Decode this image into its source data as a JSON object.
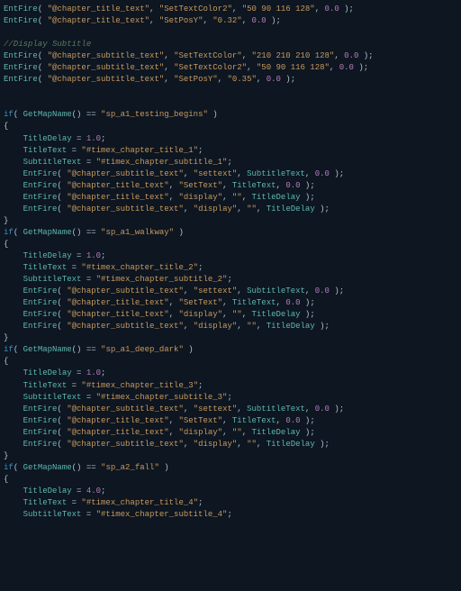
{
  "lines": [
    [
      [
        "f",
        "EntFire"
      ],
      [
        "p",
        "( "
      ],
      [
        "s",
        "\"@chapter_title_text\""
      ],
      [
        "p",
        ", "
      ],
      [
        "s",
        "\"SetTextColor2\""
      ],
      [
        "p",
        ", "
      ],
      [
        "s",
        "\"50 90 116 128\""
      ],
      [
        "p",
        ", "
      ],
      [
        "n",
        "0.0"
      ],
      [
        "p",
        " );"
      ]
    ],
    [
      [
        "f",
        "EntFire"
      ],
      [
        "p",
        "( "
      ],
      [
        "s",
        "\"@chapter_title_text\""
      ],
      [
        "p",
        ", "
      ],
      [
        "s",
        "\"SetPosY\""
      ],
      [
        "p",
        ", "
      ],
      [
        "s",
        "\"0.32\""
      ],
      [
        "p",
        ", "
      ],
      [
        "n",
        "0.0"
      ],
      [
        "p",
        " );"
      ]
    ],
    [],
    [
      [
        "c",
        "//Display Subtitle"
      ]
    ],
    [
      [
        "f",
        "EntFire"
      ],
      [
        "p",
        "( "
      ],
      [
        "s",
        "\"@chapter_subtitle_text\""
      ],
      [
        "p",
        ", "
      ],
      [
        "s",
        "\"SetTextColor\""
      ],
      [
        "p",
        ", "
      ],
      [
        "s",
        "\"210 210 210 128\""
      ],
      [
        "p",
        ", "
      ],
      [
        "n",
        "0.0"
      ],
      [
        "p",
        " );"
      ]
    ],
    [
      [
        "f",
        "EntFire"
      ],
      [
        "p",
        "( "
      ],
      [
        "s",
        "\"@chapter_subtitle_text\""
      ],
      [
        "p",
        ", "
      ],
      [
        "s",
        "\"SetTextColor2\""
      ],
      [
        "p",
        ", "
      ],
      [
        "s",
        "\"50 90 116 128\""
      ],
      [
        "p",
        ", "
      ],
      [
        "n",
        "0.0"
      ],
      [
        "p",
        " );"
      ]
    ],
    [
      [
        "f",
        "EntFire"
      ],
      [
        "p",
        "( "
      ],
      [
        "s",
        "\"@chapter_subtitle_text\""
      ],
      [
        "p",
        ", "
      ],
      [
        "s",
        "\"SetPosY\""
      ],
      [
        "p",
        ", "
      ],
      [
        "s",
        "\"0.35\""
      ],
      [
        "p",
        ", "
      ],
      [
        "n",
        "0.0"
      ],
      [
        "p",
        " );"
      ]
    ],
    [],
    [],
    [
      [
        "k",
        "if"
      ],
      [
        "p",
        "( "
      ],
      [
        "f",
        "GetMapName"
      ],
      [
        "p",
        "() == "
      ],
      [
        "s",
        "\"sp_a1_testing_begins\""
      ],
      [
        "p",
        " )"
      ]
    ],
    [
      [
        "p",
        "{"
      ]
    ],
    [
      [
        "p",
        "    "
      ],
      [
        "f",
        "TitleDelay"
      ],
      [
        "p",
        " = "
      ],
      [
        "n",
        "1.0"
      ],
      [
        "p",
        ";"
      ]
    ],
    [
      [
        "p",
        "    "
      ],
      [
        "f",
        "TitleText"
      ],
      [
        "p",
        " = "
      ],
      [
        "s",
        "\"#timex_chapter_title_1\""
      ],
      [
        "p",
        ";"
      ]
    ],
    [
      [
        "p",
        "    "
      ],
      [
        "f",
        "SubtitleText"
      ],
      [
        "p",
        " = "
      ],
      [
        "s",
        "\"#timex_chapter_subtitle_1\""
      ],
      [
        "p",
        ";"
      ]
    ],
    [
      [
        "p",
        "    "
      ],
      [
        "f",
        "EntFire"
      ],
      [
        "p",
        "( "
      ],
      [
        "s",
        "\"@chapter_subtitle_text\""
      ],
      [
        "p",
        ", "
      ],
      [
        "s",
        "\"settext\""
      ],
      [
        "p",
        ", "
      ],
      [
        "f",
        "SubtitleText"
      ],
      [
        "p",
        ", "
      ],
      [
        "n",
        "0.0"
      ],
      [
        "p",
        " );"
      ]
    ],
    [
      [
        "p",
        "    "
      ],
      [
        "f",
        "EntFire"
      ],
      [
        "p",
        "( "
      ],
      [
        "s",
        "\"@chapter_title_text\""
      ],
      [
        "p",
        ", "
      ],
      [
        "s",
        "\"SetText\""
      ],
      [
        "p",
        ", "
      ],
      [
        "f",
        "TitleText"
      ],
      [
        "p",
        ", "
      ],
      [
        "n",
        "0.0"
      ],
      [
        "p",
        " );"
      ]
    ],
    [
      [
        "p",
        "    "
      ],
      [
        "f",
        "EntFire"
      ],
      [
        "p",
        "( "
      ],
      [
        "s",
        "\"@chapter_title_text\""
      ],
      [
        "p",
        ", "
      ],
      [
        "s",
        "\"display\""
      ],
      [
        "p",
        ", "
      ],
      [
        "s",
        "\"\""
      ],
      [
        "p",
        ", "
      ],
      [
        "f",
        "TitleDelay"
      ],
      [
        "p",
        " );"
      ]
    ],
    [
      [
        "p",
        "    "
      ],
      [
        "f",
        "EntFire"
      ],
      [
        "p",
        "( "
      ],
      [
        "s",
        "\"@chapter_subtitle_text\""
      ],
      [
        "p",
        ", "
      ],
      [
        "s",
        "\"display\""
      ],
      [
        "p",
        ", "
      ],
      [
        "s",
        "\"\""
      ],
      [
        "p",
        ", "
      ],
      [
        "f",
        "TitleDelay"
      ],
      [
        "p",
        " );"
      ]
    ],
    [
      [
        "p",
        "}"
      ]
    ],
    [
      [
        "k",
        "if"
      ],
      [
        "p",
        "( "
      ],
      [
        "f",
        "GetMapName"
      ],
      [
        "p",
        "() == "
      ],
      [
        "s",
        "\"sp_a1_walkway\""
      ],
      [
        "p",
        " )"
      ]
    ],
    [
      [
        "p",
        "{"
      ]
    ],
    [
      [
        "p",
        "    "
      ],
      [
        "f",
        "TitleDelay"
      ],
      [
        "p",
        " = "
      ],
      [
        "n",
        "1.0"
      ],
      [
        "p",
        ";"
      ]
    ],
    [
      [
        "p",
        "    "
      ],
      [
        "f",
        "TitleText"
      ],
      [
        "p",
        " = "
      ],
      [
        "s",
        "\"#timex_chapter_title_2\""
      ],
      [
        "p",
        ";"
      ]
    ],
    [
      [
        "p",
        "    "
      ],
      [
        "f",
        "SubtitleText"
      ],
      [
        "p",
        " = "
      ],
      [
        "s",
        "\"#timex_chapter_subtitle_2\""
      ],
      [
        "p",
        ";"
      ]
    ],
    [
      [
        "p",
        "    "
      ],
      [
        "f",
        "EntFire"
      ],
      [
        "p",
        "( "
      ],
      [
        "s",
        "\"@chapter_subtitle_text\""
      ],
      [
        "p",
        ", "
      ],
      [
        "s",
        "\"settext\""
      ],
      [
        "p",
        ", "
      ],
      [
        "f",
        "SubtitleText"
      ],
      [
        "p",
        ", "
      ],
      [
        "n",
        "0.0"
      ],
      [
        "p",
        " );"
      ]
    ],
    [
      [
        "p",
        "    "
      ],
      [
        "f",
        "EntFire"
      ],
      [
        "p",
        "( "
      ],
      [
        "s",
        "\"@chapter_title_text\""
      ],
      [
        "p",
        ", "
      ],
      [
        "s",
        "\"SetText\""
      ],
      [
        "p",
        ", "
      ],
      [
        "f",
        "TitleText"
      ],
      [
        "p",
        ", "
      ],
      [
        "n",
        "0.0"
      ],
      [
        "p",
        " );"
      ]
    ],
    [
      [
        "p",
        "    "
      ],
      [
        "f",
        "EntFire"
      ],
      [
        "p",
        "( "
      ],
      [
        "s",
        "\"@chapter_title_text\""
      ],
      [
        "p",
        ", "
      ],
      [
        "s",
        "\"display\""
      ],
      [
        "p",
        ", "
      ],
      [
        "s",
        "\"\""
      ],
      [
        "p",
        ", "
      ],
      [
        "f",
        "TitleDelay"
      ],
      [
        "p",
        " );"
      ]
    ],
    [
      [
        "p",
        "    "
      ],
      [
        "f",
        "EntFire"
      ],
      [
        "p",
        "( "
      ],
      [
        "s",
        "\"@chapter_subtitle_text\""
      ],
      [
        "p",
        ", "
      ],
      [
        "s",
        "\"display\""
      ],
      [
        "p",
        ", "
      ],
      [
        "s",
        "\"\""
      ],
      [
        "p",
        ", "
      ],
      [
        "f",
        "TitleDelay"
      ],
      [
        "p",
        " );"
      ]
    ],
    [
      [
        "p",
        "}"
      ]
    ],
    [
      [
        "k",
        "if"
      ],
      [
        "p",
        "( "
      ],
      [
        "f",
        "GetMapName"
      ],
      [
        "p",
        "() == "
      ],
      [
        "s",
        "\"sp_a1_deep_dark\""
      ],
      [
        "p",
        " )"
      ]
    ],
    [
      [
        "p",
        "{"
      ]
    ],
    [
      [
        "p",
        "    "
      ],
      [
        "f",
        "TitleDelay"
      ],
      [
        "p",
        " = "
      ],
      [
        "n",
        "1.0"
      ],
      [
        "p",
        ";"
      ]
    ],
    [
      [
        "p",
        "    "
      ],
      [
        "f",
        "TitleText"
      ],
      [
        "p",
        " = "
      ],
      [
        "s",
        "\"#timex_chapter_title_3\""
      ],
      [
        "p",
        ";"
      ]
    ],
    [
      [
        "p",
        "    "
      ],
      [
        "f",
        "SubtitleText"
      ],
      [
        "p",
        " = "
      ],
      [
        "s",
        "\"#timex_chapter_subtitle_3\""
      ],
      [
        "p",
        ";"
      ]
    ],
    [
      [
        "p",
        "    "
      ],
      [
        "f",
        "EntFire"
      ],
      [
        "p",
        "( "
      ],
      [
        "s",
        "\"@chapter_subtitle_text\""
      ],
      [
        "p",
        ", "
      ],
      [
        "s",
        "\"settext\""
      ],
      [
        "p",
        ", "
      ],
      [
        "f",
        "SubtitleText"
      ],
      [
        "p",
        ", "
      ],
      [
        "n",
        "0.0"
      ],
      [
        "p",
        " );"
      ]
    ],
    [
      [
        "p",
        "    "
      ],
      [
        "f",
        "EntFire"
      ],
      [
        "p",
        "( "
      ],
      [
        "s",
        "\"@chapter_title_text\""
      ],
      [
        "p",
        ", "
      ],
      [
        "s",
        "\"SetText\""
      ],
      [
        "p",
        ", "
      ],
      [
        "f",
        "TitleText"
      ],
      [
        "p",
        ", "
      ],
      [
        "n",
        "0.0"
      ],
      [
        "p",
        " );"
      ]
    ],
    [
      [
        "p",
        "    "
      ],
      [
        "f",
        "EntFire"
      ],
      [
        "p",
        "( "
      ],
      [
        "s",
        "\"@chapter_title_text\""
      ],
      [
        "p",
        ", "
      ],
      [
        "s",
        "\"display\""
      ],
      [
        "p",
        ", "
      ],
      [
        "s",
        "\"\""
      ],
      [
        "p",
        ", "
      ],
      [
        "f",
        "TitleDelay"
      ],
      [
        "p",
        " );"
      ]
    ],
    [
      [
        "p",
        "    "
      ],
      [
        "f",
        "EntFire"
      ],
      [
        "p",
        "( "
      ],
      [
        "s",
        "\"@chapter_subtitle_text\""
      ],
      [
        "p",
        ", "
      ],
      [
        "s",
        "\"display\""
      ],
      [
        "p",
        ", "
      ],
      [
        "s",
        "\"\""
      ],
      [
        "p",
        ", "
      ],
      [
        "f",
        "TitleDelay"
      ],
      [
        "p",
        " );"
      ]
    ],
    [
      [
        "p",
        "}"
      ]
    ],
    [
      [
        "k",
        "if"
      ],
      [
        "p",
        "( "
      ],
      [
        "f",
        "GetMapName"
      ],
      [
        "p",
        "() == "
      ],
      [
        "s",
        "\"sp_a2_fall\""
      ],
      [
        "p",
        " )"
      ]
    ],
    [
      [
        "p",
        "{"
      ]
    ],
    [
      [
        "p",
        "    "
      ],
      [
        "f",
        "TitleDelay"
      ],
      [
        "p",
        " = "
      ],
      [
        "n",
        "4.0"
      ],
      [
        "p",
        ";"
      ]
    ],
    [
      [
        "p",
        "    "
      ],
      [
        "f",
        "TitleText"
      ],
      [
        "p",
        " = "
      ],
      [
        "s",
        "\"#timex_chapter_title_4\""
      ],
      [
        "p",
        ";"
      ]
    ],
    [
      [
        "p",
        "    "
      ],
      [
        "f",
        "SubtitleText"
      ],
      [
        "p",
        " = "
      ],
      [
        "s",
        "\"#timex_chapter_subtitle_4\""
      ],
      [
        "p",
        ";"
      ]
    ]
  ]
}
